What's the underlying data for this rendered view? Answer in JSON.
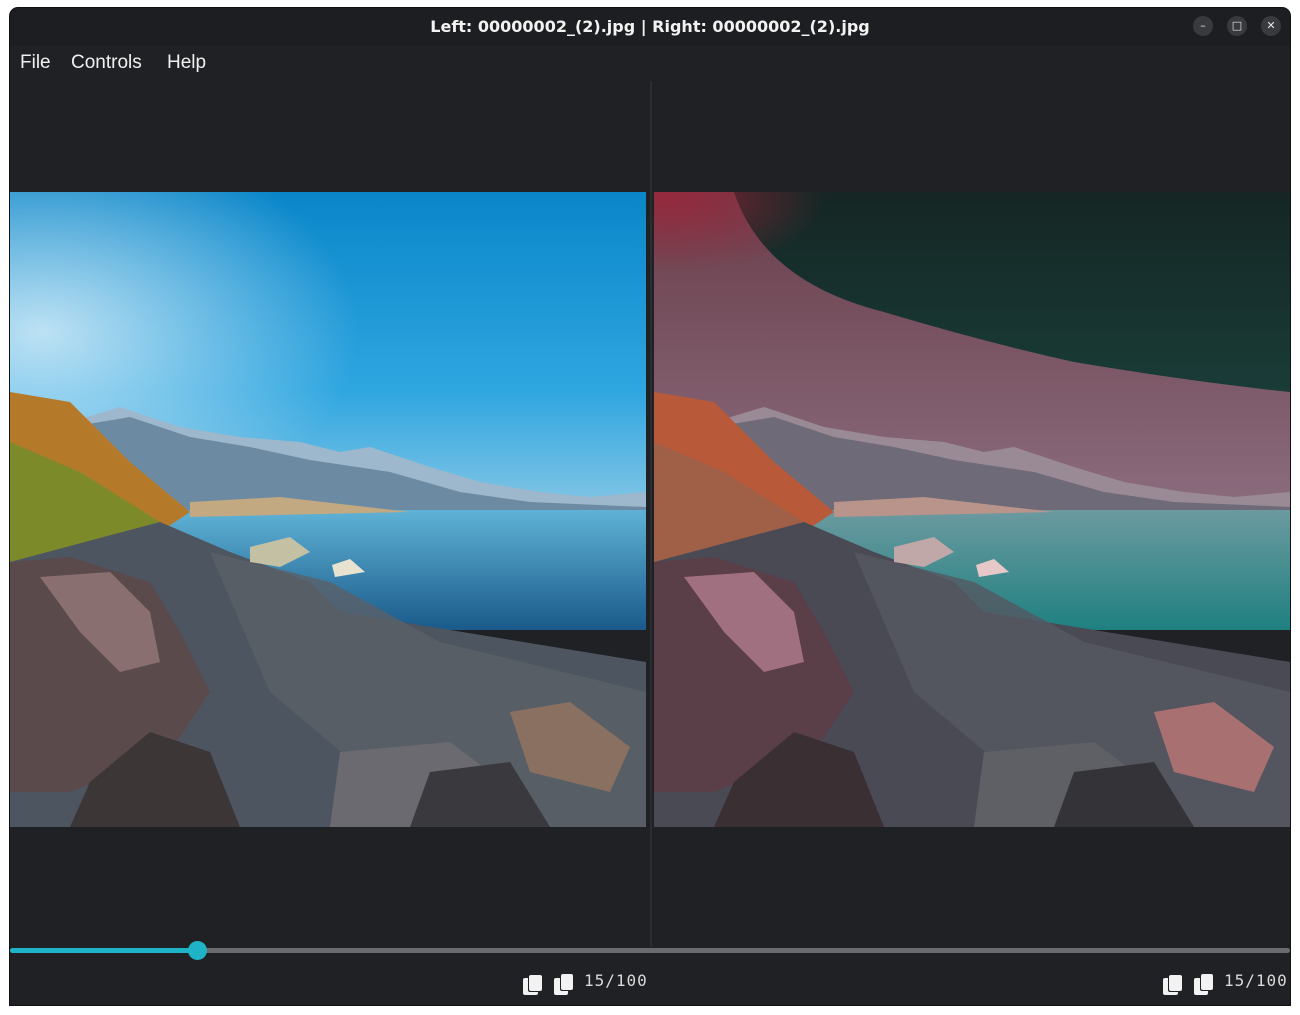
{
  "window": {
    "title": "Left: 00000002_(2).jpg | Right: 00000002_(2).jpg",
    "minimize_glyph": "–",
    "maximize_glyph": "□",
    "close_glyph": "✕"
  },
  "menu": {
    "items": [
      "File",
      "Controls",
      "Help"
    ]
  },
  "slider": {
    "progress": 0.146,
    "accent": "#1fb3c8"
  },
  "left_pane": {
    "counter": "15/100",
    "icons": [
      "copy-stack-icon",
      "copy-icon"
    ]
  },
  "right_pane": {
    "counter": "15/100",
    "icons": [
      "copy-stack-icon",
      "copy-icon"
    ]
  }
}
